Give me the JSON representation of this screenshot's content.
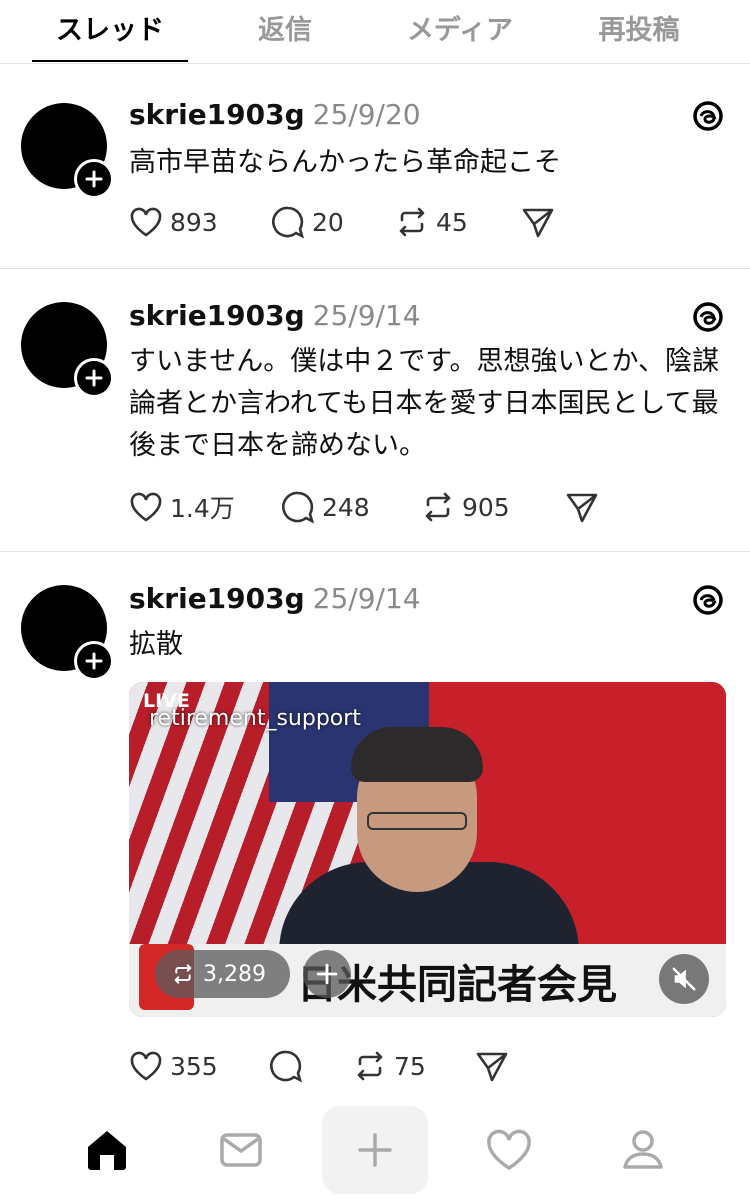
{
  "tabs": [
    "スレッド",
    "返信",
    "メディア",
    "再投稿"
  ],
  "active_tab": 0,
  "posts": [
    {
      "username": "skrie1903g",
      "date": "25/9/20",
      "text": "高市早苗ならんかったら革命起こそ",
      "likes": "893",
      "replies": "20",
      "reposts": "45"
    },
    {
      "username": "skrie1903g",
      "date": "25/9/14",
      "text": "すいません。僕は中２です。思想強いとか、陰謀論者とか言われても日本を愛す日本国民として最後まで日本を諦めない。",
      "likes": "1.4万",
      "replies": "248",
      "reposts": "905"
    },
    {
      "username": "skrie1903g",
      "date": "25/9/14",
      "text": "拡散",
      "likes": "355",
      "replies": "",
      "reposts": "75",
      "media": {
        "live_label": "LIVE",
        "handle": "retirement_support",
        "caption": "日米共同記者会見",
        "repost_count": "3,289"
      }
    }
  ],
  "nav": [
    "home-icon",
    "inbox-icon",
    "compose-icon",
    "activity-icon",
    "profile-icon"
  ],
  "colors": {
    "muted": "#999999",
    "divider": "#e5e5e5"
  }
}
